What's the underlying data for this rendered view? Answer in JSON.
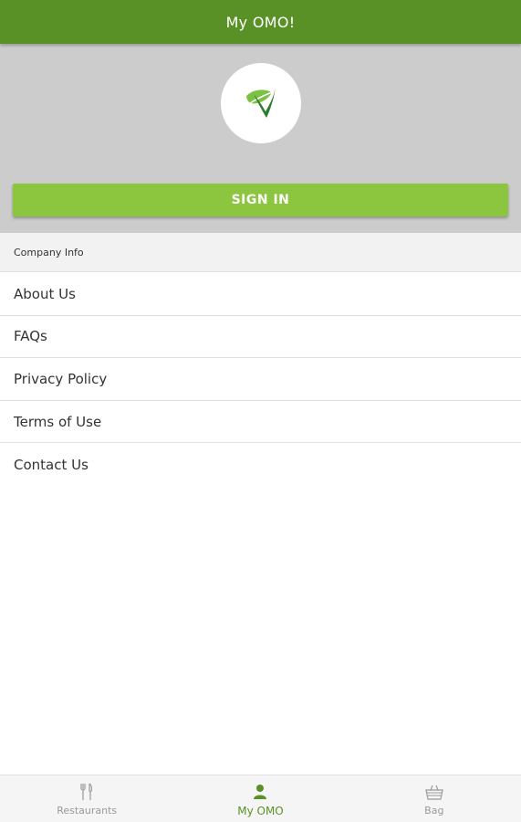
{
  "app_bar": {
    "title": "My OMO!"
  },
  "header": {
    "logo_icon": "leaf-logo-icon",
    "sign_in_label": "SIGN IN"
  },
  "section": {
    "title": "Company Info"
  },
  "menu": {
    "items": [
      {
        "label": "About Us"
      },
      {
        "label": "FAQs"
      },
      {
        "label": "Privacy Policy"
      },
      {
        "label": "Terms of Use"
      },
      {
        "label": "Contact Us"
      }
    ]
  },
  "bottom_nav": {
    "items": [
      {
        "label": "Restaurants",
        "icon": "fork-knife-icon",
        "active": false
      },
      {
        "label": "My OMO",
        "icon": "person-icon",
        "active": true
      },
      {
        "label": "Bag",
        "icon": "basket-icon",
        "active": false
      }
    ]
  },
  "colors": {
    "app_bar": "#5a9127",
    "sign_in_button": "#8cc63f",
    "header_panel": "#cccccc",
    "active_nav": "#5a9127",
    "inactive_nav": "#9a9a9a"
  }
}
